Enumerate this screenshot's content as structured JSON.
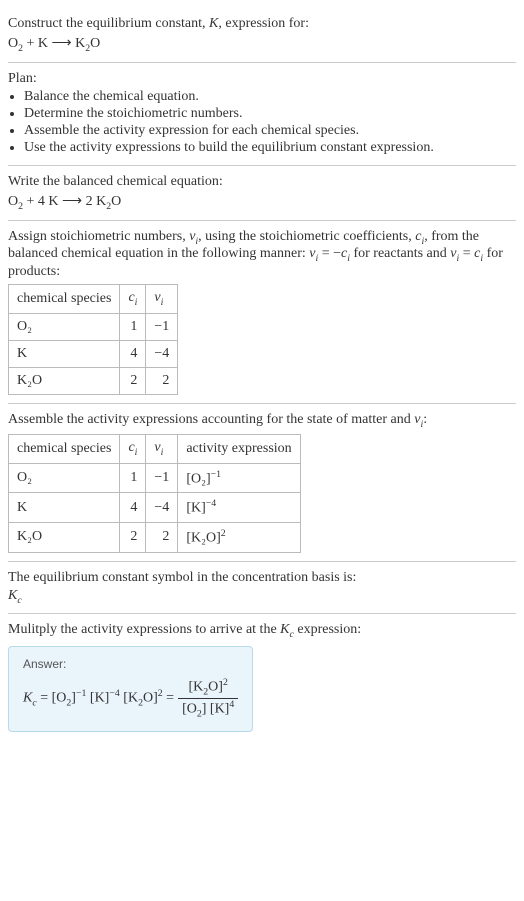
{
  "block1": {
    "line1_prefix": "Construct the equilibrium constant, ",
    "line1_K": "K",
    "line1_suffix": ", expression for:",
    "eq_lhs_o2": "O",
    "eq_lhs_o2_sub": "2",
    "eq_plus": " + K ",
    "arrow": "⟶",
    "eq_rhs": " K",
    "eq_rhs_sub": "2",
    "eq_rhs_o": "O"
  },
  "plan": {
    "title": "Plan:",
    "items": [
      "Balance the chemical equation.",
      "Determine the stoichiometric numbers.",
      "Assemble the activity expression for each chemical species.",
      "Use the activity expressions to build the equilibrium constant expression."
    ]
  },
  "block3": {
    "title": "Write the balanced chemical equation:",
    "eq_o": "O",
    "eq_2": "2",
    "eq_mid": " + 4 K ",
    "arrow": "⟶",
    "eq_rhs": " 2 K",
    "eq_rhs2": "2",
    "eq_rhsO": "O"
  },
  "block4": {
    "text_a": "Assign stoichiometric numbers, ",
    "nu": "ν",
    "i": "i",
    "text_b": ", using the stoichiometric coefficients, ",
    "c": "c",
    "text_c": ", from the balanced chemical equation in the following manner: ",
    "eq1": " = −",
    "text_d": " for reactants and ",
    "eq2": " = ",
    "text_e": " for products:",
    "headers": [
      "chemical species",
      "cᵢ",
      "νᵢ"
    ],
    "h_species": "chemical species",
    "h_c": "c",
    "h_nu": "ν",
    "rows": [
      {
        "sp": "O₂",
        "c": "1",
        "nu": "−1"
      },
      {
        "sp": "K",
        "c": "4",
        "nu": "−4"
      },
      {
        "sp": "K₂O",
        "c": "2",
        "nu": "2"
      }
    ]
  },
  "block5": {
    "title_a": "Assemble the activity expressions accounting for the state of matter and ",
    "title_nu": "ν",
    "title_i": "i",
    "title_b": ":",
    "h_species": "chemical species",
    "h_c": "c",
    "h_nu": "ν",
    "h_i": "i",
    "h_activity": "activity expression",
    "rows": [
      {
        "sp": "O₂",
        "c": "1",
        "nu": "−1",
        "act_base": "[O₂]",
        "act_exp": "−1"
      },
      {
        "sp": "K",
        "c": "4",
        "nu": "−4",
        "act_base": "[K]",
        "act_exp": "−4"
      },
      {
        "sp": "K₂O",
        "c": "2",
        "nu": "2",
        "act_base": "[K₂O]",
        "act_exp": "2"
      }
    ]
  },
  "block6": {
    "line": "The equilibrium constant symbol in the concentration basis is:",
    "K": "K",
    "c": "c"
  },
  "block7": {
    "line_a": "Mulitply the activity expressions to arrive at the ",
    "K": "K",
    "c": "c",
    "line_b": " expression:"
  },
  "answer": {
    "label": "Answer:",
    "Kc_K": "K",
    "Kc_c": "c",
    "eq": " = ",
    "t1": "[O",
    "t1s": "2",
    "t1e": "]",
    "e1": "−1",
    "t2": " [K]",
    "e2": "−4",
    "t3": " [K",
    "t3s": "2",
    "t3e": "O]",
    "e3": "2",
    "eq2": " = ",
    "num_a": "[K",
    "num_s": "2",
    "num_b": "O]",
    "num_e": "2",
    "den_a": "[O",
    "den_s": "2",
    "den_b": "] [K]",
    "den_e": "4"
  },
  "chart_data": {
    "type": "table",
    "tables": [
      {
        "title": "stoichiometric numbers",
        "columns": [
          "chemical species",
          "c_i",
          "ν_i"
        ],
        "rows": [
          [
            "O2",
            1,
            -1
          ],
          [
            "K",
            4,
            -4
          ],
          [
            "K2O",
            2,
            2
          ]
        ]
      },
      {
        "title": "activity expressions",
        "columns": [
          "chemical species",
          "c_i",
          "ν_i",
          "activity expression"
        ],
        "rows": [
          [
            "O2",
            1,
            -1,
            "[O2]^(-1)"
          ],
          [
            "K",
            4,
            -4,
            "[K]^(-4)"
          ],
          [
            "K2O",
            2,
            2,
            "[K2O]^2"
          ]
        ]
      }
    ]
  }
}
